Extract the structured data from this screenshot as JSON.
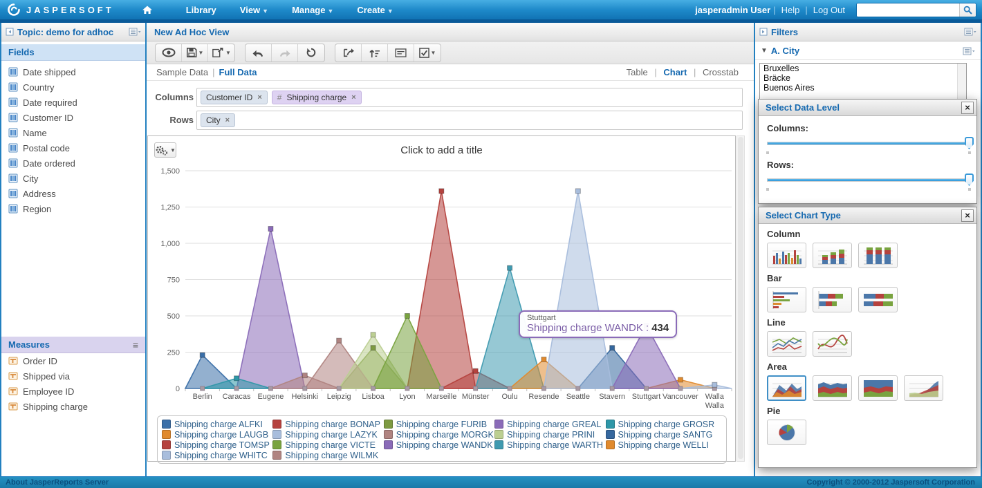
{
  "navbar": {
    "brand": "JASPERSOFT",
    "menus": [
      {
        "label": "Library",
        "caret": false
      },
      {
        "label": "View",
        "caret": true
      },
      {
        "label": "Manage",
        "caret": true
      },
      {
        "label": "Create",
        "caret": true
      }
    ],
    "user": "jasperadmin User",
    "help": "Help",
    "logout": "Log Out",
    "search_value": ""
  },
  "sidebar": {
    "title": "Topic: demo for adhoc",
    "fields_title": "Fields",
    "fields": [
      "Date shipped",
      "Country",
      "Date required",
      "Customer ID",
      "Name",
      "Postal code",
      "Date ordered",
      "City",
      "Address",
      "Region"
    ],
    "measures_title": "Measures",
    "measures": [
      "Order ID",
      "Shipped via",
      "Employee ID",
      "Shipping charge"
    ]
  },
  "main": {
    "title": "New Ad Hoc View",
    "data_modes": [
      "Sample Data",
      "Full Data"
    ],
    "active_data_mode": "Full Data",
    "view_modes": [
      "Table",
      "Chart",
      "Crosstab"
    ],
    "active_view_mode": "Chart",
    "columns_label": "Columns",
    "rows_label": "Rows",
    "column_pills": [
      {
        "prefix": "",
        "label": "Customer ID"
      },
      {
        "prefix": "#",
        "label": "Shipping charge"
      }
    ],
    "row_pills": [
      {
        "prefix": "",
        "label": "City"
      }
    ],
    "chart_title_placeholder": "Click to add a title",
    "tooltip": {
      "city": "Stuttgart",
      "label": "Shipping charge WANDK :",
      "value": "434"
    }
  },
  "chart_data": {
    "type": "area",
    "title": "",
    "categories": [
      "Berlin",
      "Caracas",
      "Eugene",
      "Helsinki",
      "Leipzig",
      "Lisboa",
      "Lyon",
      "Marseille",
      "Münster",
      "Oulu",
      "Resende",
      "Seattle",
      "Stavern",
      "Stuttgart",
      "Vancouver",
      "Walla Walla"
    ],
    "ylim": [
      0,
      1500
    ],
    "yticks": [
      0,
      250,
      500,
      750,
      1000,
      1250,
      1500
    ],
    "grid": true,
    "legend_position": "bottom",
    "series": [
      {
        "name": "Shipping charge ALFKI",
        "color": "#3a6fa8",
        "city": "Berlin",
        "value": 230
      },
      {
        "name": "Shipping charge BONAP",
        "color": "#b5423e",
        "city": "Marseille",
        "value": 1360
      },
      {
        "name": "Shipping charge FURIB",
        "color": "#7d9a41",
        "city": "Lisboa",
        "value": 280
      },
      {
        "name": "Shipping charge GREAL",
        "color": "#8a6bb8",
        "city": "Eugene",
        "value": 1100
      },
      {
        "name": "Shipping charge GROSR",
        "color": "#2e97a8",
        "city": "Caracas",
        "value": 70
      },
      {
        "name": "Shipping charge LAUGB",
        "color": "#e08a2e",
        "city": "Vancouver",
        "value": 60
      },
      {
        "name": "Shipping charge LAZYK",
        "color": "#a8bddc",
        "city": "Walla Walla",
        "value": 25
      },
      {
        "name": "Shipping charge MORGK",
        "color": "#b08481",
        "city": "Leipzig",
        "value": 330
      },
      {
        "name": "Shipping charge PRINI",
        "color": "#bccf92",
        "city": "Lisboa",
        "value": 370
      },
      {
        "name": "Shipping charge SANTG",
        "color": "#35679e",
        "city": "Stavern",
        "value": 280
      },
      {
        "name": "Shipping charge TOMSP",
        "color": "#b5423e",
        "city": "Münster",
        "value": 120
      },
      {
        "name": "Shipping charge VICTE",
        "color": "#79a33f",
        "city": "Lyon",
        "value": 500
      },
      {
        "name": "Shipping charge WANDK",
        "color": "#8a6bb8",
        "city": "Stuttgart",
        "value": 434
      },
      {
        "name": "Shipping charge WARTH",
        "color": "#3f9ab0",
        "city": "Oulu",
        "value": 830
      },
      {
        "name": "Shipping charge WELLI",
        "color": "#e08a2e",
        "city": "Resende",
        "value": 200
      },
      {
        "name": "Shipping charge WHITC",
        "color": "#a8bddc",
        "city": "Seattle",
        "value": 1360
      },
      {
        "name": "Shipping charge WILMK",
        "color": "#b08481",
        "city": "Helsinki",
        "value": 90
      }
    ]
  },
  "filters": {
    "title": "Filters",
    "group_title": "A. City",
    "options": [
      "Bruxelles",
      "Bräcke",
      "Buenos Aires"
    ]
  },
  "dialogs": {
    "data_level": {
      "title": "Select Data Level",
      "columns_label": "Columns:",
      "rows_label": "Rows:",
      "columns_value": "100%",
      "rows_value": "100%"
    },
    "chart_type": {
      "title": "Select Chart Type",
      "sections": [
        {
          "label": "Column",
          "items": [
            "column",
            "column-stacked",
            "column-pct"
          ]
        },
        {
          "label": "Bar",
          "items": [
            "bar",
            "bar-stacked",
            "bar-pct"
          ]
        },
        {
          "label": "Line",
          "items": [
            "line",
            "spline"
          ]
        },
        {
          "label": "Area",
          "items": [
            "area",
            "area-stacked",
            "area-pct",
            "area-spline"
          ],
          "selected": 0
        },
        {
          "label": "Pie",
          "items": [
            "pie"
          ]
        }
      ]
    }
  },
  "footer": {
    "left": "About JasperReports Server",
    "right": "Copyright © 2000-2012 Jaspersoft Corporation"
  }
}
